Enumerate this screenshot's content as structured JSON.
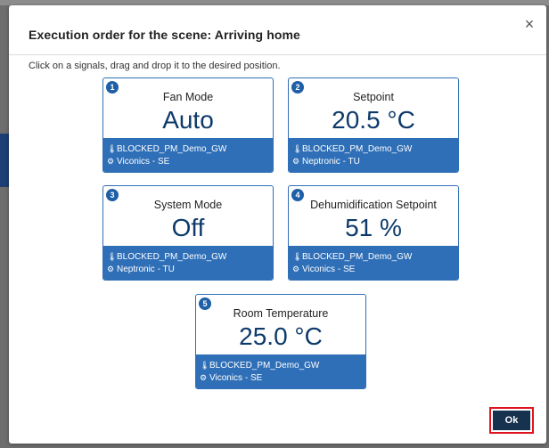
{
  "modal": {
    "title": "Execution order for the scene: Arriving home",
    "close_label": "×",
    "instructions": "Click on a signals, drag and drop it to the desired position.",
    "ok_label": "Ok"
  },
  "signals": [
    {
      "order": "1",
      "name": "Fan Mode",
      "value": "Auto",
      "gateway": "BLOCKED_PM_Demo_GW",
      "device": "Viconics - SE"
    },
    {
      "order": "2",
      "name": "Setpoint",
      "value": "20.5 °C",
      "gateway": "BLOCKED_PM_Demo_GW",
      "device": "Neptronic - TU"
    },
    {
      "order": "3",
      "name": "System Mode",
      "value": "Off",
      "gateway": "BLOCKED_PM_Demo_GW",
      "device": "Neptronic - TU"
    },
    {
      "order": "4",
      "name": "Dehumidification Setpoint",
      "value": "51 %",
      "gateway": "BLOCKED_PM_Demo_GW",
      "device": "Viconics - SE"
    },
    {
      "order": "5",
      "name": "Room Temperature",
      "value": "25.0 °C",
      "gateway": "BLOCKED_PM_Demo_GW",
      "device": "Viconics - SE"
    }
  ],
  "icons": {
    "gateway": "thermometer-icon",
    "device": "device-icon"
  }
}
